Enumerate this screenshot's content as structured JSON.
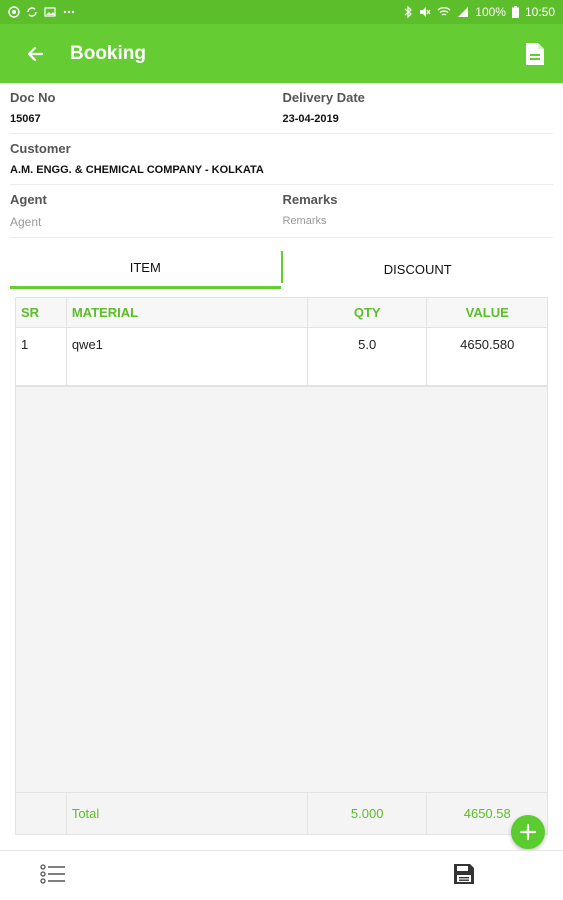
{
  "status_bar": {
    "battery": "100%",
    "time": "10:50"
  },
  "app_bar": {
    "title": "Booking"
  },
  "form": {
    "doc_no_label": "Doc No",
    "doc_no_value": "15067",
    "delivery_date_label": "Delivery Date",
    "delivery_date_value": "23-04-2019",
    "customer_label": "Customer",
    "customer_value": "A.M. ENGG. & CHEMICAL COMPANY - KOLKATA",
    "agent_label": "Agent",
    "agent_placeholder": "Agent",
    "remarks_label": "Remarks",
    "remarks_placeholder": "Remarks"
  },
  "tabs": [
    {
      "label": "ITEM",
      "active": true
    },
    {
      "label": "DISCOUNT",
      "active": false
    }
  ],
  "table": {
    "headers": {
      "sr": "SR",
      "material": "MATERIAL",
      "qty": "QTY",
      "value": "VALUE"
    },
    "rows": [
      {
        "sr": "1",
        "material": "qwe1",
        "qty": "5.0",
        "value": "4650.580"
      }
    ],
    "footer": {
      "label": "Total",
      "qty": "5.000",
      "value": "4650.58"
    }
  },
  "colors": {
    "accent": "#66cc33",
    "status_bar": "#5bbe2a"
  },
  "icons": {
    "back": "arrow-left-icon",
    "document": "document-icon",
    "add": "plus-icon",
    "list": "list-icon",
    "save": "floppy-disk-icon"
  }
}
